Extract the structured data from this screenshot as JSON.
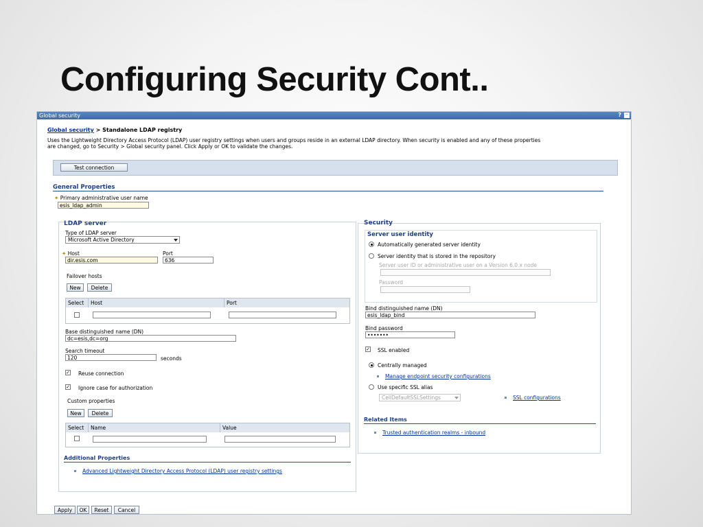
{
  "slide": {
    "title": "Configuring Security Cont.."
  },
  "window": {
    "title": "Global security",
    "help": "?",
    "minimize": "–"
  },
  "breadcrumb": {
    "link": "Global security",
    "separator": ">",
    "current": "Standalone LDAP registry"
  },
  "description": [
    "Uses the Lightweight Directory Access Protocol (LDAP) user registry settings when users and groups reside in an external LDAP directory. When security is enabled and any of these properties",
    "are changed, go to Security > Global security panel. Click Apply or OK to validate the changes."
  ],
  "test_connection_label": "Test connection",
  "general_properties": {
    "heading": "General Properties",
    "primary_admin_label": "Primary administrative user name",
    "primary_admin_value": "esis_ldap_admin"
  },
  "ldap_server": {
    "heading": "LDAP server",
    "type_label": "Type of LDAP server",
    "type_value": "Microsoft Active Directory",
    "host_label": "Host",
    "host_value": "dir.esis.com",
    "port_label": "Port",
    "port_value": "636",
    "failover_label": "Failover hosts",
    "new_label": "New",
    "delete_label": "Delete",
    "failover_columns": [
      "Select",
      "Host",
      "Port"
    ],
    "base_dn_label": "Base distinguished name (DN)",
    "base_dn_value": "dc=esis,dc=org",
    "search_timeout_label": "Search timeout",
    "search_timeout_value": "120",
    "seconds_label": "seconds",
    "reuse_label": "Reuse connection",
    "reuse_checked": true,
    "ignore_case_label": "Ignore case for authorization",
    "ignore_case_checked": true,
    "custom_props_label": "Custom properties",
    "custom_columns": [
      "Select",
      "Name",
      "Value"
    ]
  },
  "additional_properties": {
    "heading": "Additional Properties",
    "link": "Advanced Lightweight Directory Access Protocol (LDAP) user registry settings"
  },
  "security": {
    "heading": "Security",
    "server_identity_heading": "Server user identity",
    "auto_identity_label": "Automatically generated server identity",
    "auto_identity_selected": true,
    "stored_identity_label": "Server identity that is stored in the repository",
    "server_user_id_label": "Server user ID or administrative user on a Version 6.0.x node",
    "password_label": "Password",
    "bind_dn_label": "Bind distinguished name (DN)",
    "bind_dn_value": "esis_ldap_bind",
    "bind_password_label": "Bind password",
    "bind_password_value": "•••••••",
    "ssl_enabled_label": "SSL enabled",
    "ssl_enabled_checked": true,
    "centrally_managed_label": "Centrally managed",
    "centrally_managed_selected": true,
    "manage_endpoint_link": "Manage endpoint security configurations",
    "specific_alias_label": "Use specific SSL alias",
    "ssl_alias_value": "CellDefaultSSLSettings",
    "ssl_config_link": "SSL configurations"
  },
  "related_items": {
    "heading": "Related Items",
    "link": "Trusted authentication realms - inbound"
  },
  "footer_buttons": {
    "apply": "Apply",
    "ok": "OK",
    "reset": "Reset",
    "cancel": "Cancel"
  }
}
